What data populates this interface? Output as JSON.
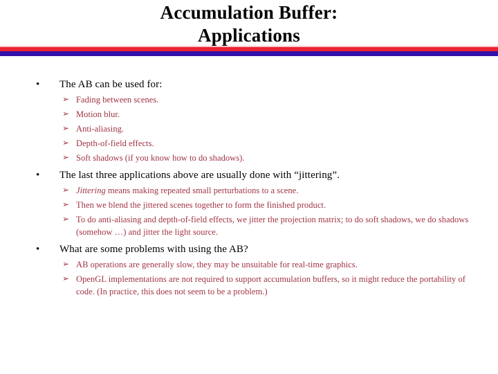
{
  "slide": {
    "title_line1": "Accumulation Buffer:",
    "title_line2": "Applications",
    "colors": {
      "title_text": "#000000",
      "rule_pink": "#f9c9ca",
      "rule_red": "#ee2233",
      "rule_blue": "#3311aa",
      "level1_text": "#000000",
      "level2_text": "#a03343"
    },
    "markers": {
      "level1": "•",
      "level1_icon_name": "round-bullet-icon",
      "level2": "➢",
      "level2_icon_name": "arrowhead-bullet-icon"
    },
    "groups": [
      {
        "heading": "The AB can be used for:",
        "subpoints": [
          {
            "text": "Fading between scenes."
          },
          {
            "text": "Motion blur."
          },
          {
            "text": "Anti-aliasing."
          },
          {
            "text": "Depth-of-field effects."
          },
          {
            "text": "Soft shadows (if you know how to do shadows)."
          }
        ]
      },
      {
        "heading": "The last three applications above are usually done with “jittering”.",
        "subpoints": [
          {
            "italic_lead": "Jittering",
            "text": " means making repeated small perturbations to a scene."
          },
          {
            "text": "Then we blend the jittered scenes together to form the finished product."
          },
          {
            "text": "To do anti-aliasing and depth-of-field effects, we jitter the projection matrix; to do soft shadows, we do shadows (somehow …) and jitter the light source."
          }
        ]
      },
      {
        "heading": "What are some problems with using the AB?",
        "subpoints": [
          {
            "text": "AB operations are generally slow, they may be unsuitable for real-time graphics."
          },
          {
            "text": "OpenGL implementations are not required to support accumulation buffers, so it might reduce the portability of code. (In practice, this does not seem to be a problem.)"
          }
        ]
      }
    ]
  }
}
